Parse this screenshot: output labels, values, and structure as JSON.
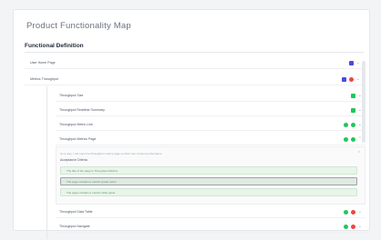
{
  "page": {
    "title": "Product Functionality Map"
  },
  "section": {
    "title": "Functional Definition"
  },
  "top_rows": [
    {
      "label": "User Home Page"
    },
    {
      "label": "Metrics Throughput"
    }
  ],
  "sub_rows": [
    {
      "label": "Throughput Size"
    },
    {
      "label": "Throughput Realtime Summary"
    },
    {
      "label": "Throughput Metric Link"
    },
    {
      "label": "Throughput Metrics Page"
    }
  ],
  "expanded": {
    "description": "As a user, I can view the throughput metrics page so that I can monitor performance",
    "acceptance_label": "Acceptance Criteria",
    "criteria": [
      "The title of the page is Throughput Metrics",
      "The page contains a metrics graph panel",
      "The page contains a metrics table panel"
    ]
  },
  "bottom_rows": [
    {
      "label": "Throughput Data Table"
    },
    {
      "label": "Throughput Navigate"
    }
  ],
  "colors": {
    "accent": "#4f46e5",
    "success": "#22c55e",
    "danger": "#ef4444"
  },
  "icons": {
    "expand": "chevron-down-icon",
    "collapse": "chevron-up-icon",
    "scrollbar": "scrollbar"
  }
}
